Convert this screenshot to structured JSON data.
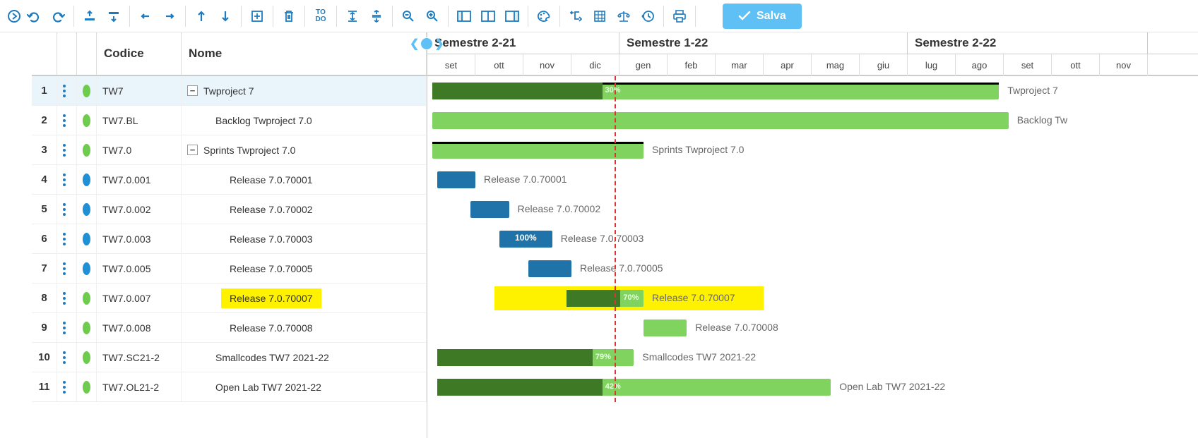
{
  "toolbar": {
    "save_label": "Salva",
    "todo_top": "TO",
    "todo_bot": "DO"
  },
  "table": {
    "head_code": "Codice",
    "head_name": "Nome"
  },
  "rows": [
    {
      "n": "1",
      "status": "green",
      "code": "TW7",
      "name": "Twproject 7",
      "indent": 0,
      "expand": true,
      "hl": false
    },
    {
      "n": "2",
      "status": "green",
      "code": "TW7.BL",
      "name": "Backlog Twproject 7.0",
      "indent": 1,
      "expand": false,
      "hl": false
    },
    {
      "n": "3",
      "status": "green",
      "code": "TW7.0",
      "name": "Sprints Twproject 7.0",
      "indent": 0,
      "expand": true,
      "hl": false
    },
    {
      "n": "4",
      "status": "blue",
      "code": "TW7.0.001",
      "name": "Release 7.0.70001",
      "indent": 2,
      "expand": false,
      "hl": false
    },
    {
      "n": "5",
      "status": "blue",
      "code": "TW7.0.002",
      "name": "Release 7.0.70002",
      "indent": 2,
      "expand": false,
      "hl": false
    },
    {
      "n": "6",
      "status": "blue",
      "code": "TW7.0.003",
      "name": "Release 7.0.70003",
      "indent": 2,
      "expand": false,
      "hl": false
    },
    {
      "n": "7",
      "status": "blue",
      "code": "TW7.0.005",
      "name": "Release 7.0.70005",
      "indent": 2,
      "expand": false,
      "hl": false
    },
    {
      "n": "8",
      "status": "green",
      "code": "TW7.0.007",
      "name": "Release 7.0.70007",
      "indent": 2,
      "expand": false,
      "hl": true
    },
    {
      "n": "9",
      "status": "green",
      "code": "TW7.0.008",
      "name": "Release 7.0.70008",
      "indent": 2,
      "expand": false,
      "hl": false
    },
    {
      "n": "10",
      "status": "green",
      "code": "TW7.SC21-2",
      "name": "Smallcodes TW7 2021-22",
      "indent": 1,
      "expand": false,
      "hl": false
    },
    {
      "n": "11",
      "status": "green",
      "code": "TW7.OL21-2",
      "name": "Open Lab TW7 2021-22",
      "indent": 1,
      "expand": false,
      "hl": false
    }
  ],
  "timeline": {
    "semesters": [
      "Semestre 2-21",
      "Semestre 1-22",
      "Semestre 2-22"
    ],
    "months": [
      "set",
      "ott",
      "nov",
      "dic",
      "gen",
      "feb",
      "mar",
      "apr",
      "mag",
      "giu",
      "lug",
      "ago",
      "set",
      "ott",
      "nov"
    ]
  },
  "chart_data": {
    "type": "bar",
    "today_month_index": 4.4,
    "bars": [
      {
        "row": 0,
        "start": 0.6,
        "end": 12.4,
        "color": "green",
        "progress": 30,
        "progress_label": "30%",
        "label": "Twproject 7",
        "topline": true
      },
      {
        "row": 1,
        "start": 0.6,
        "end": 12.6,
        "color": "green",
        "label": "Backlog Tw"
      },
      {
        "row": 2,
        "start": 0.6,
        "end": 5.0,
        "color": "green",
        "label": "Sprints Twproject 7.0",
        "topline": true
      },
      {
        "row": 3,
        "start": 0.7,
        "end": 1.5,
        "color": "blue",
        "label": "Release 7.0.70001"
      },
      {
        "row": 4,
        "start": 1.4,
        "end": 2.2,
        "color": "blue",
        "label": "Release 7.0.70002"
      },
      {
        "row": 5,
        "start": 2.0,
        "end": 3.1,
        "color": "blue",
        "progress_label": "100%",
        "label": "Release 7.0.70003"
      },
      {
        "row": 6,
        "start": 2.6,
        "end": 3.5,
        "color": "blue",
        "label": "Release 7.0.70005"
      },
      {
        "row": 7,
        "start": 3.4,
        "end": 5.0,
        "color": "green",
        "progress": 70,
        "progress_label": "70%",
        "label": "Release 7.0.70007",
        "hl_start": 1.9,
        "hl_end": 7.5
      },
      {
        "row": 8,
        "start": 5.0,
        "end": 5.9,
        "color": "green",
        "label": "Release 7.0.70008"
      },
      {
        "row": 9,
        "start": 0.7,
        "end": 4.8,
        "color": "green",
        "progress": 79,
        "progress_label": "79%",
        "label": "Smallcodes TW7 2021-22"
      },
      {
        "row": 10,
        "start": 0.7,
        "end": 8.9,
        "color": "green",
        "progress": 42,
        "progress_label": "42%",
        "label": "Open Lab TW7 2021-22"
      }
    ]
  }
}
